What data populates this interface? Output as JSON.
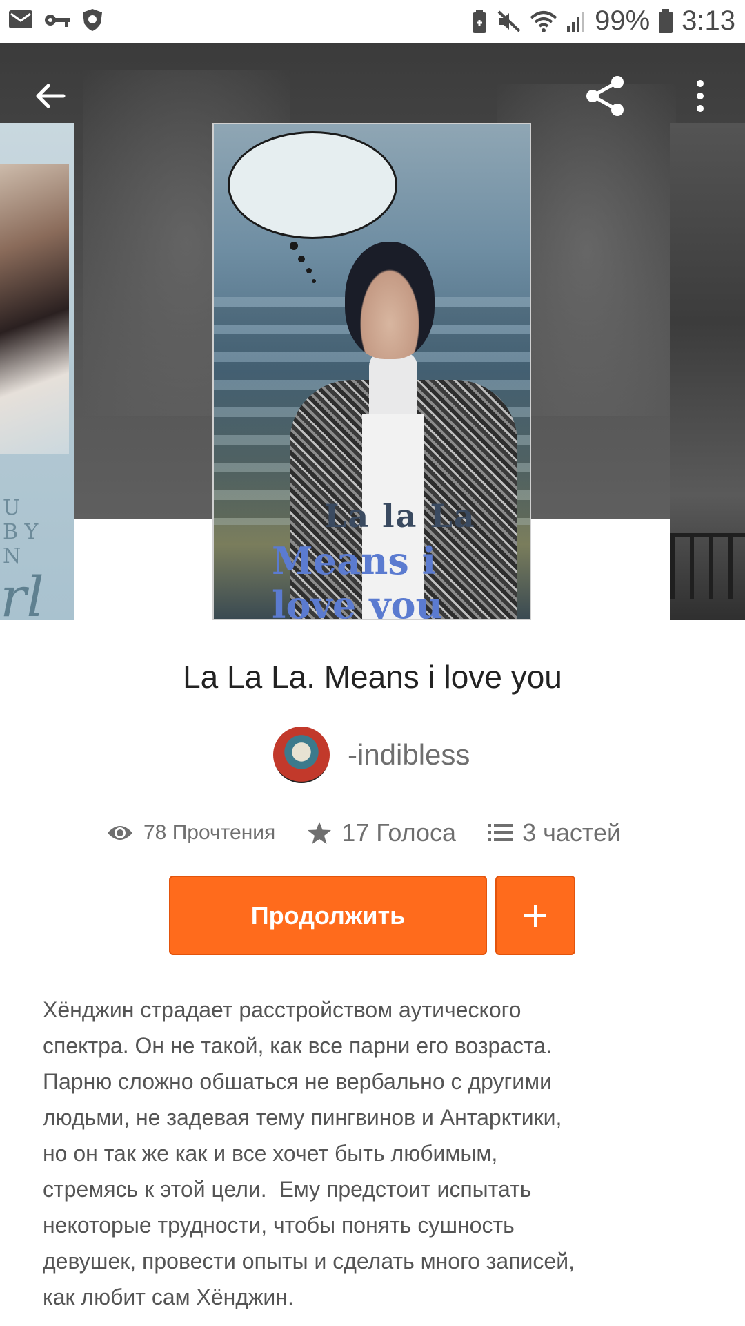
{
  "status_bar": {
    "battery": "99%",
    "time": "3:13",
    "icons": [
      "mail-icon",
      "key-icon",
      "shield-icon",
      "battery-saver-icon",
      "mute-icon",
      "wifi-icon",
      "signal-icon",
      "battery-icon"
    ]
  },
  "header": {
    "icons": [
      "back-arrow-icon",
      "share-icon",
      "more-vertical-icon"
    ]
  },
  "cover": {
    "title_line1": "La la La",
    "title_line2": "Means i love you"
  },
  "story": {
    "title": "La La La. Means i love you",
    "author": "-indibless",
    "stats": {
      "reads": "78 Прочтения",
      "votes": "17 Голоса",
      "parts": "3 частей"
    },
    "continue_label": "Продолжить",
    "add_label": "+",
    "description": "Хёнджин страдает расстройством аутического\nспектра. Он не такой, как все парни его возраста.\nПарню сложно обшаться не вербально с другими\nлюдьми, не задевая тему пингвинов и Антарктики,\nно он так же как и все хочет быть любимым,\nстремясь к этой цели.  Ему предстоит испытать\nнекоторые трудности, чтобы понять сушность\nдевушек, провести опыты и сделать много записей,\nкак любит сам Хёнджин."
  },
  "colors": {
    "accent": "#ff6b1c",
    "text_dark": "#222222",
    "text_muted": "#6f6f6f"
  }
}
